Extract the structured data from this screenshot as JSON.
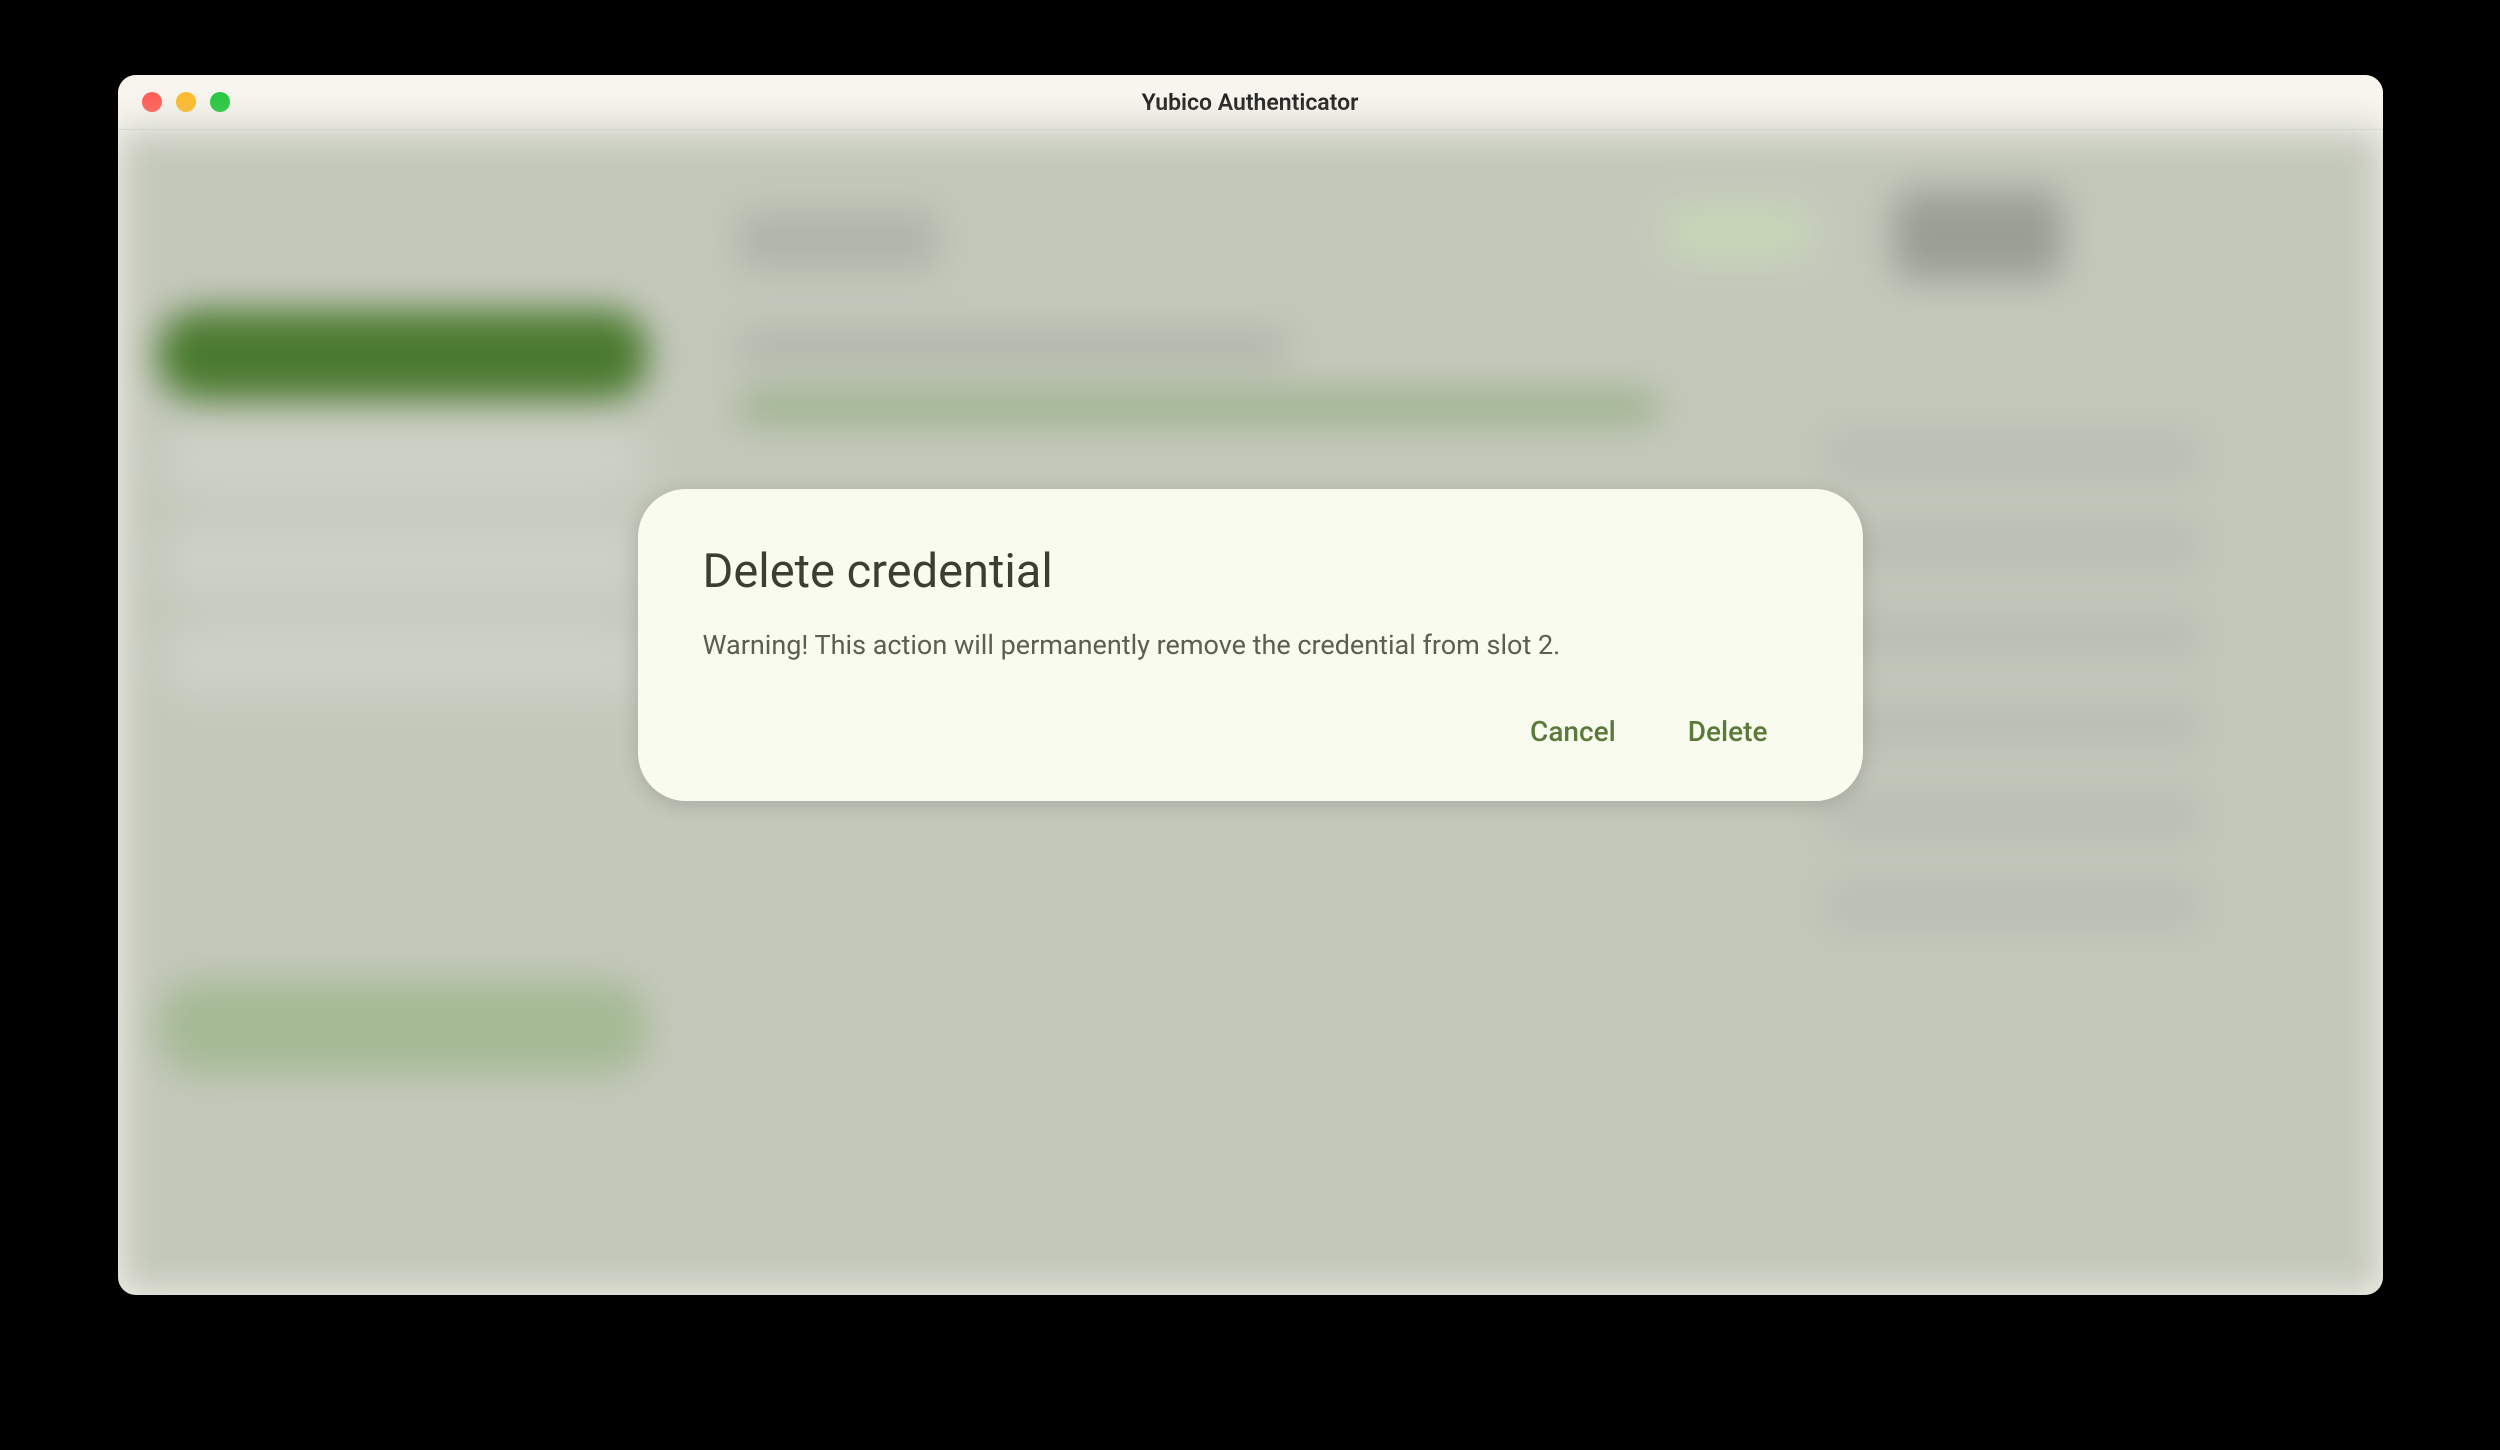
{
  "window": {
    "title": "Yubico Authenticator"
  },
  "dialog": {
    "title": "Delete credential",
    "body": "Warning! This action will permanently remove the credential from slot 2.",
    "cancel_label": "Cancel",
    "confirm_label": "Delete"
  }
}
